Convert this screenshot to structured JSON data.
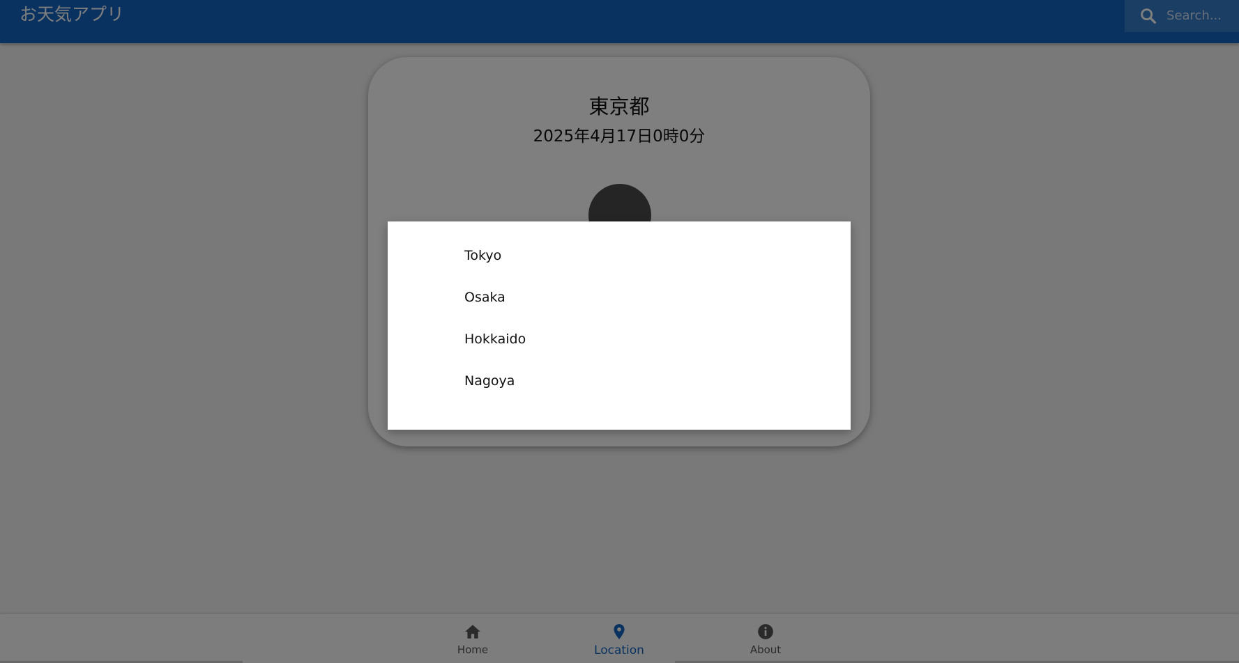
{
  "app": {
    "title": "お天気アプリ"
  },
  "search": {
    "placeholder": "Search..."
  },
  "card": {
    "city": "東京都",
    "datetime": "2025年4月17日0時0分"
  },
  "menu": {
    "items": [
      {
        "label": "Tokyo"
      },
      {
        "label": "Osaka"
      },
      {
        "label": "Hokkaido"
      },
      {
        "label": "Nagoya"
      }
    ]
  },
  "nav": {
    "items": [
      {
        "label": "Home",
        "icon": "home-icon",
        "active": false
      },
      {
        "label": "Location",
        "icon": "location-pin-icon",
        "active": true
      },
      {
        "label": "About",
        "icon": "info-icon",
        "active": false
      }
    ]
  },
  "colors": {
    "primary": "#1565c0",
    "scrim": "rgba(0,0,0,0.5)"
  }
}
